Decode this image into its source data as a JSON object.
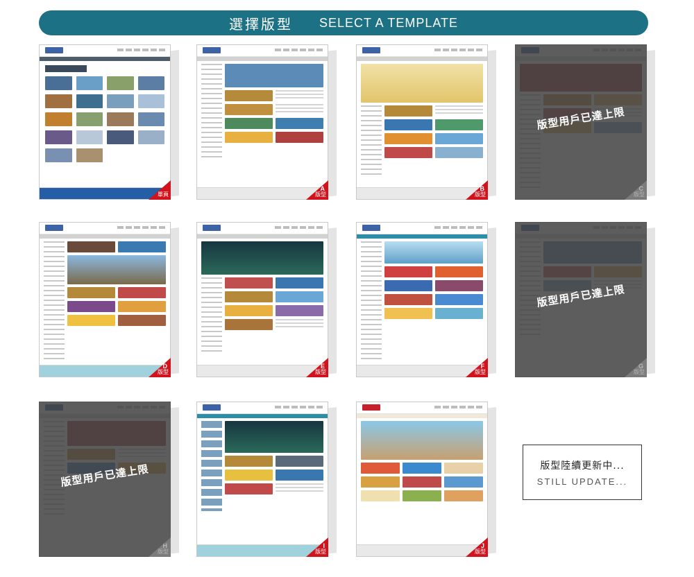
{
  "header": {
    "title_zh": "選擇版型",
    "title_en": "SELECT A TEMPLATE"
  },
  "colors": {
    "header_bar": "#1c7185",
    "badge": "#d0131d",
    "disabled_overlay": "#424242"
  },
  "overlay_text": "版型用戶已達上限",
  "templates": [
    {
      "letter": "",
      "label": "單頁",
      "disabled": false
    },
    {
      "letter": "A",
      "label": "版型",
      "disabled": false
    },
    {
      "letter": "B",
      "label": "版型",
      "disabled": false
    },
    {
      "letter": "C",
      "label": "版型",
      "disabled": true
    },
    {
      "letter": "D",
      "label": "版型",
      "disabled": false
    },
    {
      "letter": "E",
      "label": "版型",
      "disabled": false
    },
    {
      "letter": "F",
      "label": "版型",
      "disabled": false
    },
    {
      "letter": "G",
      "label": "版型",
      "disabled": true
    },
    {
      "letter": "H",
      "label": "版型",
      "disabled": true
    },
    {
      "letter": "I",
      "label": "版型",
      "disabled": false
    },
    {
      "letter": "J",
      "label": "版型",
      "disabled": false
    }
  ],
  "notice": {
    "zh": "版型陸續更新中...",
    "en": "STILL UPDATE..."
  }
}
